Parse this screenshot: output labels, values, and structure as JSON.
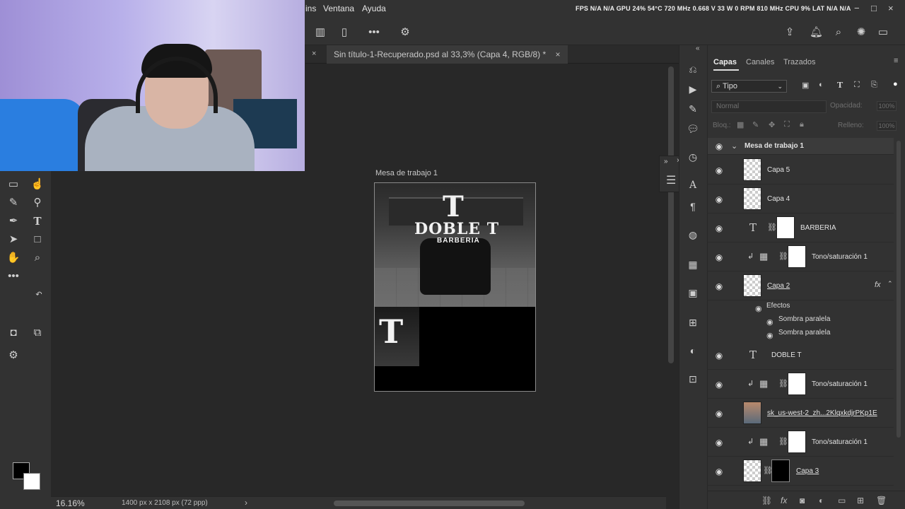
{
  "menubar": {
    "items": [
      "ins",
      "Ventana",
      "Ayuda"
    ],
    "perf": "FPS  N/A  N/A   GPU 24%  54°C  720 MHz  0.668 V  33 W  0 RPM  810 MHz   CPU  9%   LAT  N/A  N/A",
    "window_controls": [
      "−",
      "□",
      "×"
    ]
  },
  "optionsbar": {
    "icons": [
      "align-icon",
      "distribute-icon",
      "more-icon",
      "settings-icon",
      "share-icon",
      "bell-icon",
      "search-icon",
      "lightbulb-icon",
      "workspace-icon"
    ]
  },
  "document": {
    "tab_title": "Sin título-1-Recuperado.psd al 33,3% (Capa 4, RGB/8) *",
    "artboard_label": "Mesa de trabajo 1"
  },
  "artwork": {
    "logo_letter": "T",
    "brand_name": "DOBLE T",
    "brand_sub": "BARBERIA"
  },
  "statusbar": {
    "zoom": "16.16%",
    "doc_size": "1400 px x 2108 px (72 ppp)",
    "arrow": "›"
  },
  "panel": {
    "tabs": [
      "Capas",
      "Canales",
      "Trazados"
    ],
    "filter": "Tipo",
    "blend_mode": "Normal",
    "opacity_label": "Opacidad:",
    "opacity_value": "100%",
    "lock_label": "Bloq.:",
    "fill_label": "Relleno:",
    "fill_value": "100%"
  },
  "layers": {
    "group": "Mesa de trabajo 1",
    "capa5": "Capa 5",
    "capa4": "Capa 4",
    "barberia": "BARBERIA",
    "tono1": "Tono/saturación 1",
    "capa2": "Capa 2",
    "fx": "fx",
    "efectos": "Efectos",
    "sombra1": "Sombra paralela",
    "sombra2": "Sombra paralela",
    "dobleT": "DOBLE T",
    "tono2": "Tono/saturación 1",
    "sk": "sk_us-west-2_zh...2KlqxkdjrPKp1E",
    "tono3": "Tono/saturación 1",
    "capa3": "Capa 3"
  },
  "colors": {
    "foreground": "#000000",
    "background": "#ffffff",
    "ui_bg": "#282828",
    "panel_bg": "#323232"
  }
}
